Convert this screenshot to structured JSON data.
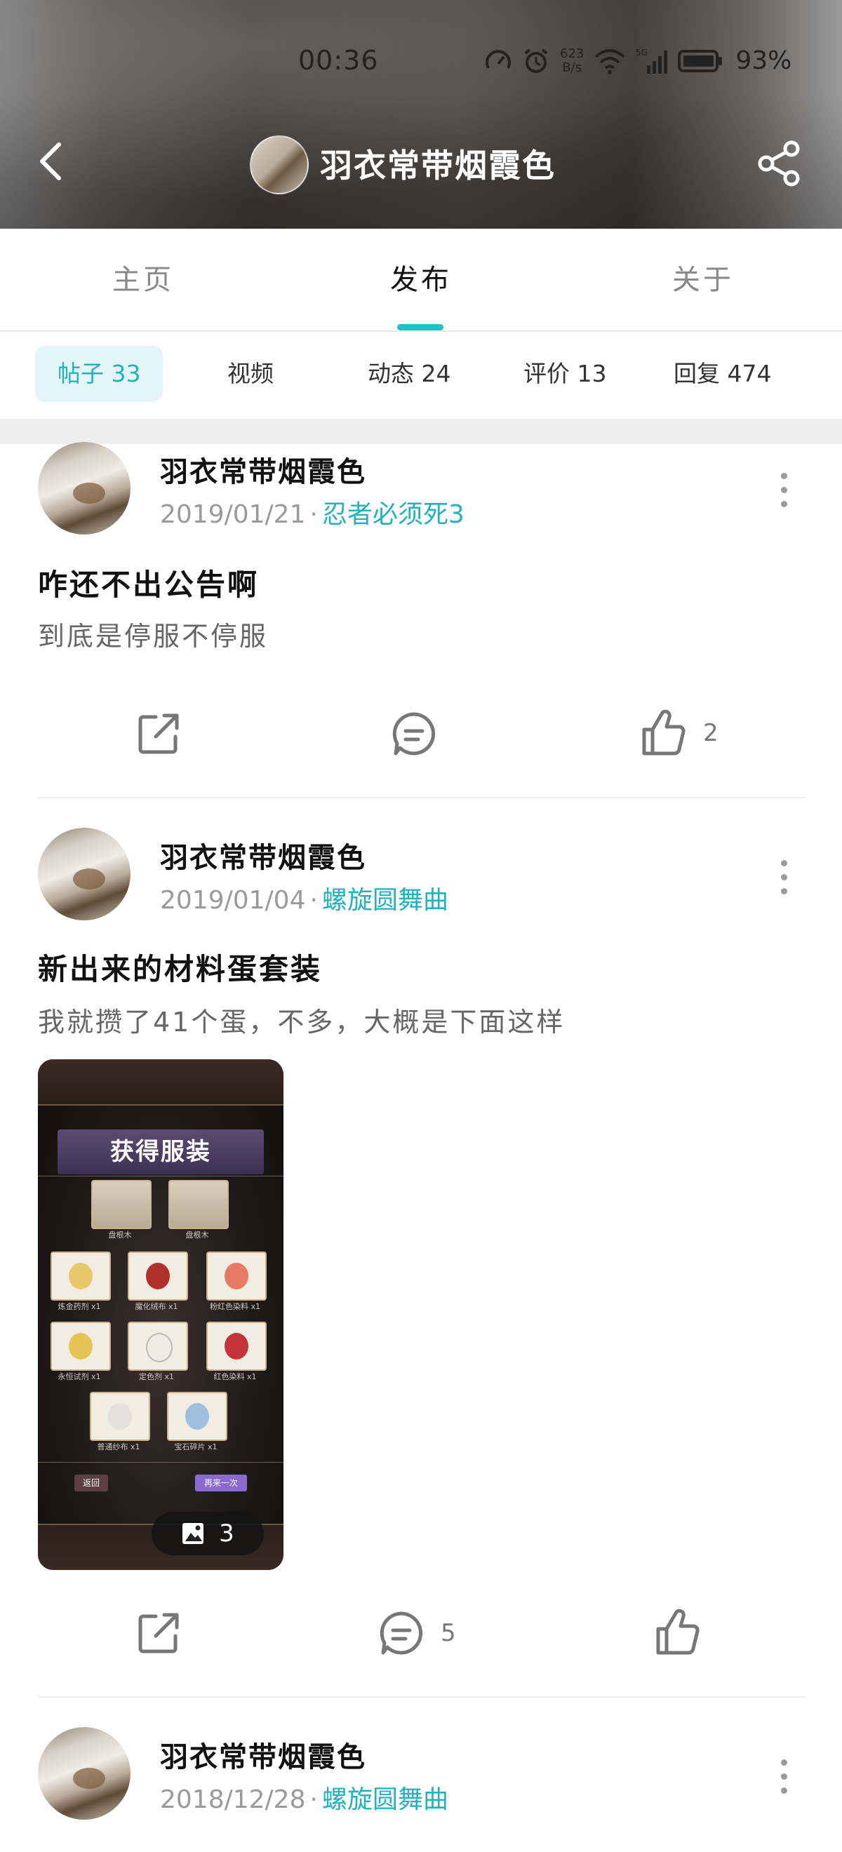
{
  "status_bar": {
    "time": "00:36",
    "net_speed_top": "623",
    "net_speed_bottom": "B/s",
    "battery": "93%"
  },
  "header": {
    "title": "羽衣常带烟霞色"
  },
  "tabs": [
    {
      "label": "主页"
    },
    {
      "label": "发布"
    },
    {
      "label": "关于"
    }
  ],
  "subtabs": [
    {
      "label": "帖子 33"
    },
    {
      "label": "视频"
    },
    {
      "label": "动态 24"
    },
    {
      "label": "评价 13"
    },
    {
      "label": "回复 474"
    }
  ],
  "posts": [
    {
      "author": "羽衣常带烟霞色",
      "date": "2019/01/21",
      "separator": "·",
      "topic": "忍者必须死3",
      "title": "咋还不出公告啊",
      "body": "到底是停服不停服",
      "like_count": "2",
      "comment_count": ""
    },
    {
      "author": "羽衣常带烟霞色",
      "date": "2019/01/04",
      "separator": "·",
      "topic": "螺旋圆舞曲",
      "title": "新出来的材料蛋套装",
      "body": "我就攒了41个蛋，不多，大概是下面这样",
      "image_count": "3",
      "comment_count": "5",
      "like_count": "",
      "image": {
        "banner": "获得服装",
        "items": [
          {
            "label": "盘根木"
          },
          {
            "label": "盘根木"
          },
          {
            "label": "炼金药剂 x1"
          },
          {
            "label": "魔化绒布 x1"
          },
          {
            "label": "粉红色染料 x1"
          },
          {
            "label": "永恒试剂 x1"
          },
          {
            "label": "定色剂 x1"
          },
          {
            "label": "红色染料 x1"
          },
          {
            "label": "普通纱布 x1"
          },
          {
            "label": "宝石碎片 x1"
          }
        ],
        "button_left": "返回",
        "button_right": "再来一次"
      }
    },
    {
      "author": "羽衣常带烟霞色",
      "date": "2018/12/28",
      "separator": "·",
      "topic": "螺旋圆舞曲"
    }
  ],
  "colors": {
    "accent": "#21c1c8",
    "topic": "#21b2bc",
    "subtab_active_bg": "#e3f5f8"
  }
}
